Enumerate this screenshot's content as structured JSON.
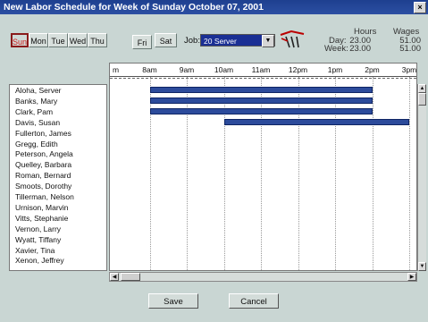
{
  "window": {
    "title": "New Labor Schedule for Week of Sunday October 07, 2001",
    "close": "×"
  },
  "days": [
    "Sun",
    "Mon",
    "Tue",
    "Wed",
    "Thu",
    "Fri",
    "Sat"
  ],
  "active_day": "Sun",
  "job": {
    "label": "Job:",
    "value": "20 Server"
  },
  "summary": {
    "hours_header": "Hours",
    "wages_header": "Wages",
    "day_label": "Day:",
    "week_label": "Week:",
    "day_hours": "23.00",
    "day_wages": "51.00",
    "week_hours": "23.00",
    "week_wages": "51.00"
  },
  "hours": [
    "m",
    "8am",
    "9am",
    "10am",
    "11am",
    "12pm",
    "1pm",
    "2pm",
    "3pm"
  ],
  "employees": [
    "Aloha, Server",
    "Banks, Mary",
    "Clark, Pam",
    "Davis, Susan",
    "Fullerton, James",
    "Gregg, Edith",
    "Peterson, Angela",
    "Quelley, Barbara",
    "Roman, Bernard",
    "Smoots, Dorothy",
    "Tillerman, Nelson",
    "Urnison, Marvin",
    "Vitts, Stephanie",
    "Vernon, Larry",
    "Wyatt, Tiffany",
    "Xavier, Tina",
    "Xenon, Jeffrey"
  ],
  "shifts": [
    {
      "employee": "Aloha, Server",
      "start": "8am",
      "end": "2pm"
    },
    {
      "employee": "Banks, Mary",
      "start": "8am",
      "end": "2pm"
    },
    {
      "employee": "Clark, Pam",
      "start": "8am",
      "end": "2pm"
    },
    {
      "employee": "Davis, Susan",
      "start": "10am",
      "end": "3pm"
    }
  ],
  "buttons": {
    "save": "Save",
    "cancel": "Cancel"
  },
  "colors": {
    "title_bar": "#1e3f8f",
    "shift_bar": "#2c4b9b",
    "active_day": "#d21a1a",
    "job_select": "#1a2f94"
  }
}
